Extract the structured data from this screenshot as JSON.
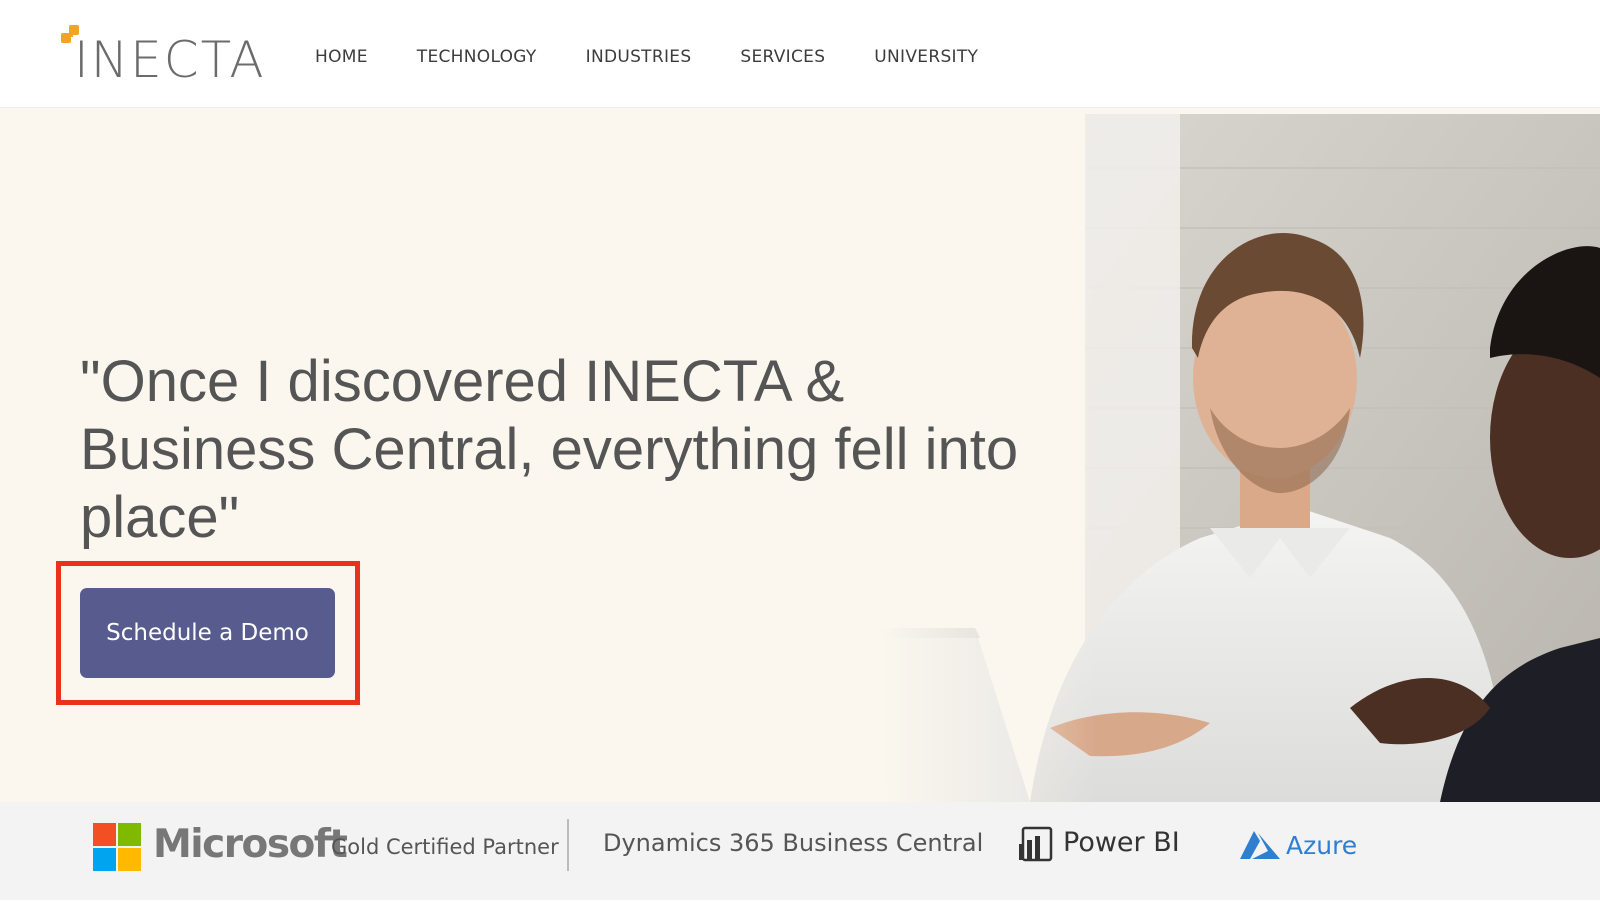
{
  "header": {
    "logo_text": "INECTA",
    "nav": [
      {
        "label": "HOME"
      },
      {
        "label": "TECHNOLOGY"
      },
      {
        "label": "INDUSTRIES"
      },
      {
        "label": "SERVICES"
      },
      {
        "label": "UNIVERSITY"
      }
    ]
  },
  "hero": {
    "quote": "\"Once I discovered INECTA & Business Central, everything fell into place\"",
    "cta_label": "Schedule a Demo"
  },
  "partners": {
    "microsoft": "Microsoft",
    "gold_certified": "Gold Certified Partner",
    "dynamics": "Dynamics 365 Business Central",
    "powerbi": "Power BI",
    "azure": "Azure"
  },
  "colors": {
    "brand_orange": "#f0a525",
    "hero_bg": "#fbf7ee",
    "cta_bg": "#575b8e",
    "highlight_red": "#e8321e",
    "azure_blue": "#2f7fd1"
  }
}
